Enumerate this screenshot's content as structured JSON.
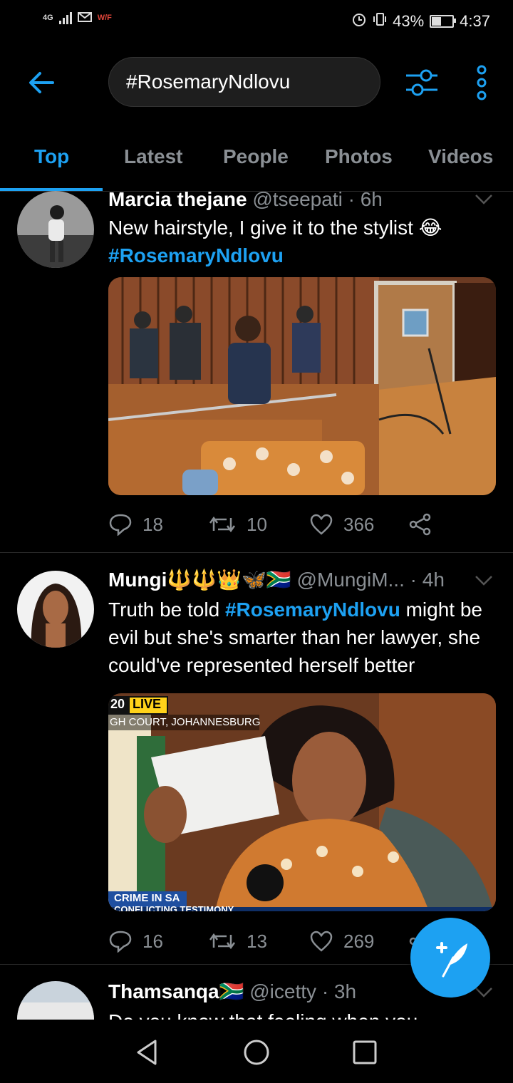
{
  "status_bar": {
    "network": "4G",
    "time": "4:37",
    "battery": "43%",
    "battery_level": 0.43
  },
  "search": {
    "query": "#RosemaryNdlovu"
  },
  "tabs": [
    {
      "label": "Top",
      "active": true
    },
    {
      "label": "Latest",
      "active": false
    },
    {
      "label": "People",
      "active": false
    },
    {
      "label": "Photos",
      "active": false
    },
    {
      "label": "Videos",
      "active": false
    }
  ],
  "tweets": [
    {
      "name": "Marcia thejane",
      "handle": "@tseepati",
      "time": "6h",
      "text": "New hairstyle, I give it to the stylist 😂",
      "hashtag": "#RosemaryNdlovu",
      "replies": "18",
      "retweets": "10",
      "likes": "366"
    },
    {
      "name": "Mungi🔱🔱👑🦋🇿🇦",
      "handle": "@MungiM...",
      "time": "4h",
      "text_before": "Truth be told ",
      "hashtag": "#RosemaryNdlovu",
      "text_after": " might be evil but she's smarter than her lawyer, she could've represented herself better",
      "media_overlay": {
        "badge_num": "20",
        "badge_live": "LIVE",
        "location": "GH COURT, JOHANNESBURG",
        "segment": "CRIME IN SA",
        "ticker": "CONFLICTING TESTIMONY"
      },
      "replies": "16",
      "retweets": "13",
      "likes": "269"
    },
    {
      "name": "Thamsanqa🇿🇦",
      "handle": "@icetty",
      "time": "3h",
      "text": "Do you know that feeling when you"
    }
  ],
  "colors": {
    "accent": "#1da1f2",
    "muted": "#8a8f94",
    "background": "#000000"
  }
}
